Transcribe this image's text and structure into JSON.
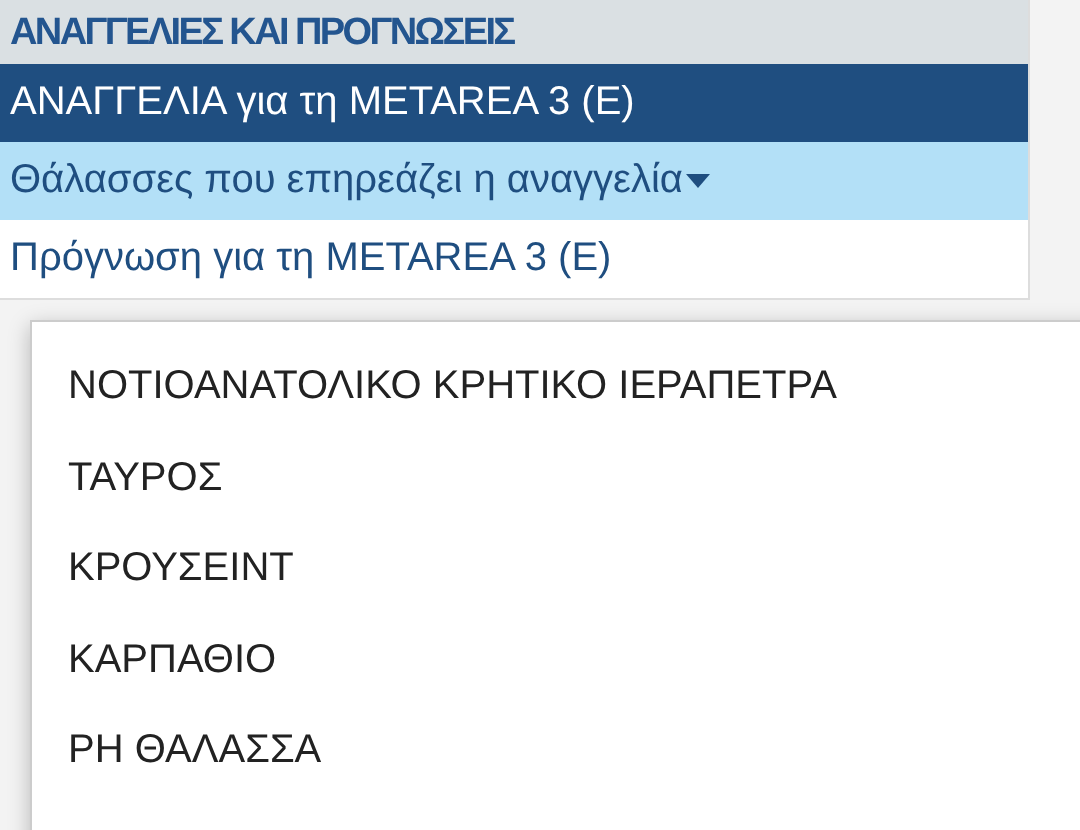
{
  "panel": {
    "title": "ΑΝΑΓΓΕΛΙΕΣ ΚΑΙ ΠΡΟΓΝΩΣΕΙΣ",
    "items": [
      {
        "label": "ΑΝΑΓΓΕΛΙΑ για τη METAREA 3 (E)",
        "kind": "link",
        "selected": true
      },
      {
        "label": "Θάλασσες που επηρεάζει η αναγγελία",
        "kind": "dropdown",
        "selected": false,
        "expanded": true
      },
      {
        "label": "Πρόγνωση για τη METAREA 3 (E)",
        "kind": "link",
        "selected": false
      }
    ]
  },
  "menu": {
    "items": [
      {
        "label": "ΝΟΤΙΟΑΝΑΤΟΛΙΚΟ ΚΡΗΤΙΚΟ ΙΕΡΑΠΕΤΡΑ"
      },
      {
        "label": "ΤΑΥΡΟΣ"
      },
      {
        "label": "ΚΡΟΥΣΕΙΝΤ"
      },
      {
        "label": "ΚΑΡΠΑΘΙΟ"
      },
      {
        "label": "ΡΗ ΘΑΛΑΣΣΑ"
      }
    ]
  }
}
